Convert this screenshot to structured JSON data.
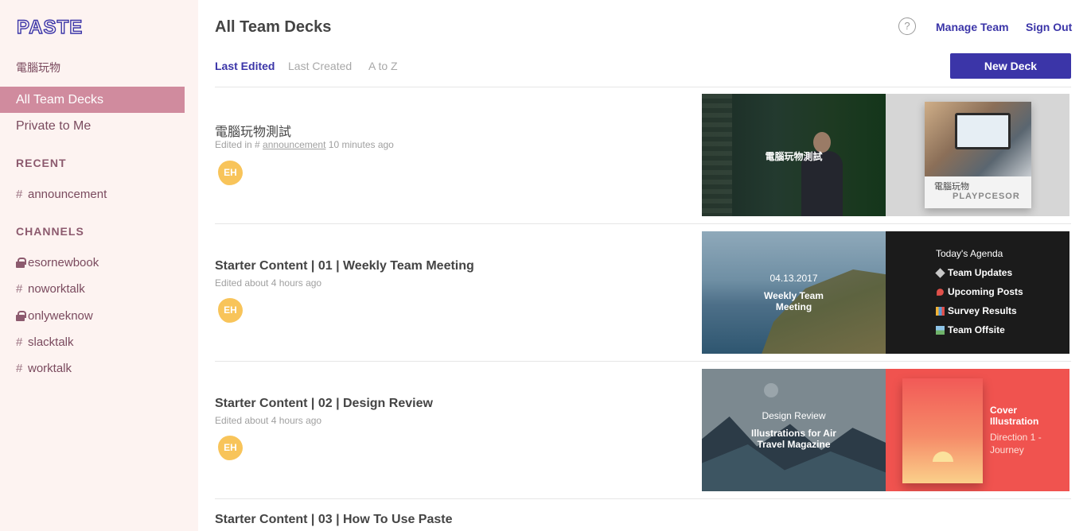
{
  "app": {
    "logo": "PASTE",
    "team_name": "電腦玩物"
  },
  "sidebar": {
    "nav": [
      {
        "label": "All Team Decks",
        "active": true
      },
      {
        "label": "Private to Me",
        "active": false
      }
    ],
    "recent_label": "RECENT",
    "recent": [
      {
        "prefix": "#",
        "name": "announcement"
      }
    ],
    "channels_label": "CHANNELS",
    "channels": [
      {
        "name": "esornewbook",
        "private": true
      },
      {
        "name": "noworktalk",
        "private": false
      },
      {
        "name": "onlyweknow",
        "private": true
      },
      {
        "name": "slacktalk",
        "private": false
      },
      {
        "name": "worktalk",
        "private": false
      }
    ]
  },
  "header": {
    "title": "All Team Decks",
    "help_glyph": "?",
    "manage_team": "Manage Team",
    "sign_out": "Sign Out"
  },
  "sort_tabs": [
    {
      "label": "Last Edited",
      "active": true
    },
    {
      "label": "Last Created",
      "active": false
    },
    {
      "label": "A to Z",
      "active": false
    }
  ],
  "new_deck_label": "New Deck",
  "decks": [
    {
      "title": "電腦玩物測試",
      "meta_prefix": "Edited in # ",
      "meta_channel": "announcement",
      "meta_suffix": " 10 minutes ago",
      "avatar": "EH",
      "slide1": {
        "caption": "電腦玩物測試"
      },
      "slide2": {
        "line1": "電腦玩物",
        "line2": "PLAYPCESOR"
      }
    },
    {
      "title": "Starter Content | 01 | Weekly Team Meeting",
      "meta": "Edited about 4 hours ago",
      "avatar": "EH",
      "slide1": {
        "date": "04.13.2017",
        "caption": "Weekly Team Meeting"
      },
      "slide2": {
        "heading": "Today's Agenda",
        "items": [
          {
            "icon": "diamond-icon",
            "label": "Team Updates",
            "color": "#c8c8c8"
          },
          {
            "icon": "pin-icon",
            "label": "Upcoming Posts",
            "color": "#e0504a"
          },
          {
            "icon": "chart-icon",
            "label": "Survey Results",
            "color": "#f2b233"
          },
          {
            "icon": "landscape-icon",
            "label": "Team Offsite",
            "color": "#6fb36a"
          }
        ]
      }
    },
    {
      "title": "Starter Content | 02 | Design Review",
      "meta": "Edited about 4 hours ago",
      "avatar": "EH",
      "slide1": {
        "heading": "Design Review",
        "caption": "Illustrations for Air Travel Magazine"
      },
      "slide2": {
        "label_bold": "Cover Illustration",
        "label": "Direction 1 - Journey"
      }
    },
    {
      "title": "Starter Content | 03 | How To Use Paste"
    }
  ],
  "colors": {
    "accent": "#3b35a8",
    "sidebar_bg": "#fdf3f1",
    "sidebar_active": "#d08b9e",
    "avatar": "#f8c45a"
  }
}
